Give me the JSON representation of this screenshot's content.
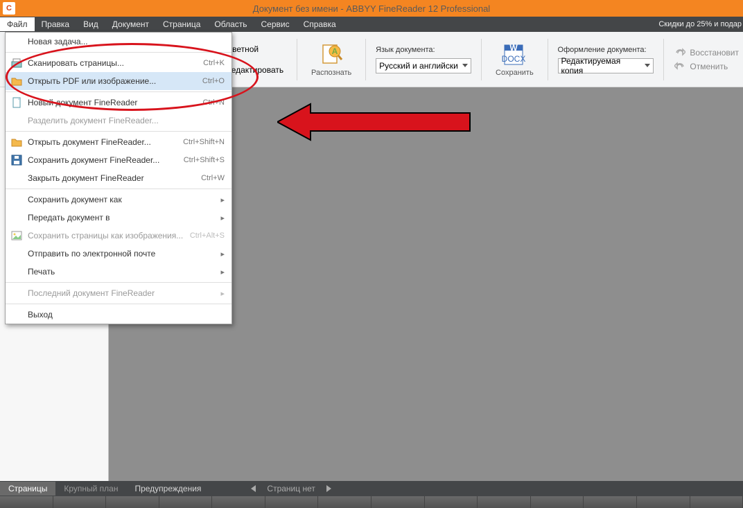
{
  "title": "Документ без имени - ABBYY FineReader 12 Professional",
  "menubar": [
    "Файл",
    "Правка",
    "Вид",
    "Документ",
    "Страница",
    "Область",
    "Сервис",
    "Справка"
  ],
  "promo": "Скидки до 25% и подар",
  "toolbar": {
    "color_mode": "Цветной",
    "edit": "Редактировать",
    "recognize": "Распознать",
    "lang_label": "Язык документа:",
    "lang_value": "Русский и английски",
    "save": "Сохранить",
    "format_label": "Оформление документа:",
    "format_value": "Редактируемая копия",
    "restore": "Восстановит",
    "undo": "Отменить"
  },
  "dropdown": [
    {
      "type": "item",
      "label": "Новая задача...",
      "shortcut": "",
      "icon": ""
    },
    {
      "type": "sep"
    },
    {
      "type": "item",
      "label": "Сканировать страницы...",
      "shortcut": "Ctrl+K",
      "icon": "scanner"
    },
    {
      "type": "item",
      "label": "Открыть PDF или изображение...",
      "shortcut": "Ctrl+O",
      "icon": "folder",
      "highlight": true
    },
    {
      "type": "sep"
    },
    {
      "type": "item",
      "label": "Новый документ FineReader",
      "shortcut": "Ctrl+N",
      "icon": "newdoc"
    },
    {
      "type": "item",
      "label": "Разделить документ FineReader...",
      "shortcut": "",
      "disabled": true
    },
    {
      "type": "sep"
    },
    {
      "type": "item",
      "label": "Открыть документ FineReader...",
      "shortcut": "Ctrl+Shift+N",
      "icon": "folder2"
    },
    {
      "type": "item",
      "label": "Сохранить документ FineReader...",
      "shortcut": "Ctrl+Shift+S",
      "icon": "disk"
    },
    {
      "type": "item",
      "label": "Закрыть документ FineReader",
      "shortcut": "Ctrl+W"
    },
    {
      "type": "sep"
    },
    {
      "type": "item",
      "label": "Сохранить документ как",
      "shortcut": "",
      "submenu": true
    },
    {
      "type": "item",
      "label": "Передать документ в",
      "shortcut": "",
      "submenu": true
    },
    {
      "type": "item",
      "label": "Сохранить страницы как изображения...",
      "shortcut": "Ctrl+Alt+S",
      "disabled": true,
      "icon": "image"
    },
    {
      "type": "item",
      "label": "Отправить по электронной почте",
      "shortcut": "",
      "submenu": true
    },
    {
      "type": "item",
      "label": "Печать",
      "shortcut": "",
      "submenu": true
    },
    {
      "type": "sep"
    },
    {
      "type": "item",
      "label": "Последний документ FineReader",
      "shortcut": "",
      "submenu": true,
      "disabled": true
    },
    {
      "type": "sep"
    },
    {
      "type": "item",
      "label": "Выход",
      "shortcut": ""
    }
  ],
  "status": {
    "tabs": [
      "Страницы",
      "Крупный план",
      "Предупреждения"
    ],
    "pages": "Страниц нет"
  }
}
